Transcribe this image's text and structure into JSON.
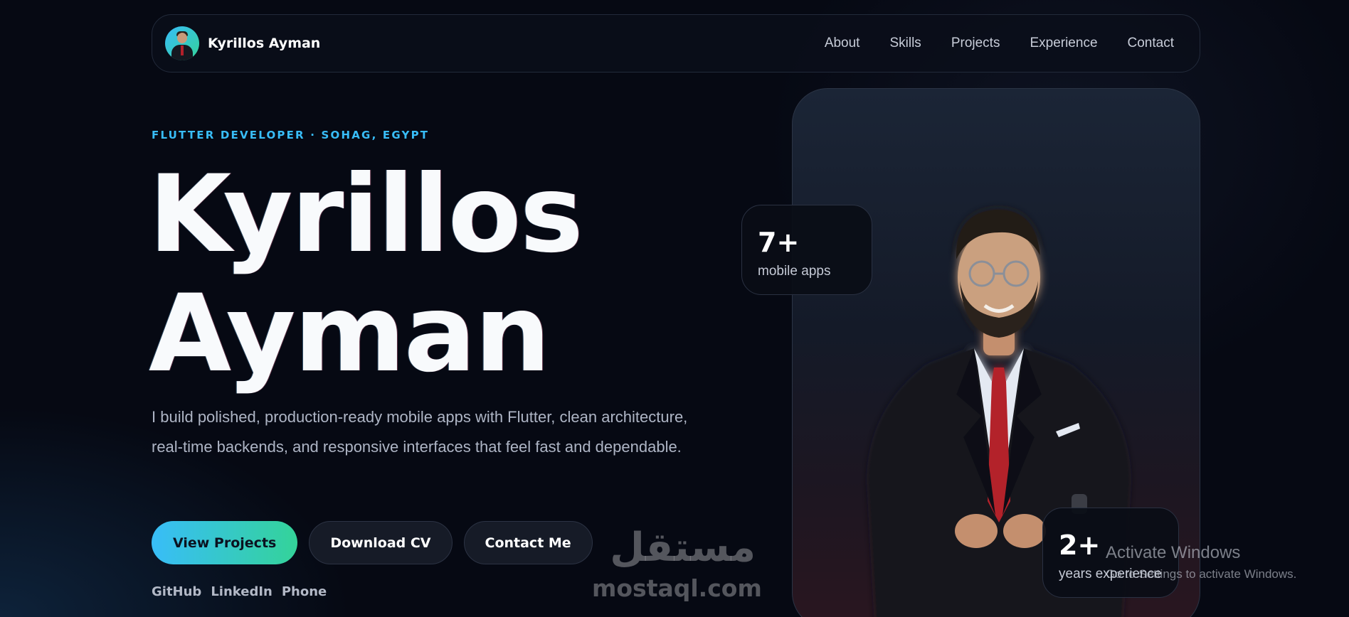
{
  "nav": {
    "brand_name": "Kyrillos Ayman",
    "links": [
      "About",
      "Skills",
      "Projects",
      "Experience",
      "Contact"
    ]
  },
  "hero": {
    "eyebrow": "FLUTTER DEVELOPER · SOHAG, EGYPT",
    "first_name": "Kyrillos",
    "last_name": "Ayman",
    "description": "I build polished, production-ready mobile apps with Flutter, clean architecture, real-time backends, and responsive interfaces that feel fast and dependable.",
    "buttons": {
      "view_projects": "View Projects",
      "download_cv": "Download CV",
      "contact_me": "Contact Me"
    },
    "socials": [
      "GitHub",
      "LinkedIn",
      "Phone"
    ]
  },
  "stats": [
    {
      "value": "7+",
      "label": "mobile apps"
    },
    {
      "value": "2+",
      "label": "years experience"
    }
  ],
  "watermark": {
    "arabic": "مستقل",
    "latin": "mostaql.com"
  },
  "os_overlay": {
    "title": "Activate Windows",
    "subtitle": "Go to Settings to activate Windows."
  },
  "colors": {
    "background": "#060913",
    "accent_blue": "#38bdf8",
    "accent_green": "#34d399",
    "text_primary": "#f8fafc",
    "text_muted": "#aeb5c5"
  },
  "icons": {
    "avatar": "profile-photo"
  }
}
